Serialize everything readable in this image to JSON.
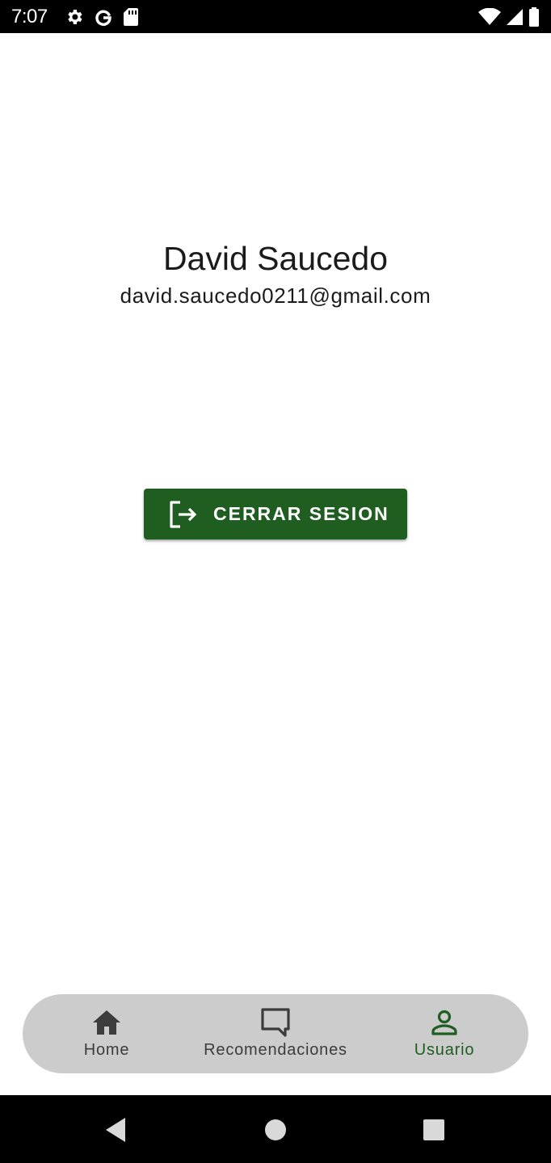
{
  "status_bar": {
    "time": "7:07",
    "left_icons": [
      "gear-icon",
      "google-icon",
      "sd-card-icon"
    ],
    "right_icons": [
      "wifi-icon",
      "cell-signal-icon",
      "battery-icon"
    ]
  },
  "profile": {
    "name": "David Saucedo",
    "email": "david.saucedo0211@gmail.com"
  },
  "logout_button": {
    "label": "CERRAR SESION",
    "icon": "logout-icon"
  },
  "bottom_nav": {
    "items": [
      {
        "label": "Home",
        "icon": "home-icon",
        "active": false
      },
      {
        "label": "Recomendaciones",
        "icon": "chat-bubble-icon",
        "active": false
      },
      {
        "label": "Usuario",
        "icon": "person-icon",
        "active": true
      }
    ]
  },
  "colors": {
    "accent": "#1f5e20",
    "nav_background": "#cccccc",
    "text": "#1b1b1b",
    "inactive_nav": "#3c3c3c"
  }
}
